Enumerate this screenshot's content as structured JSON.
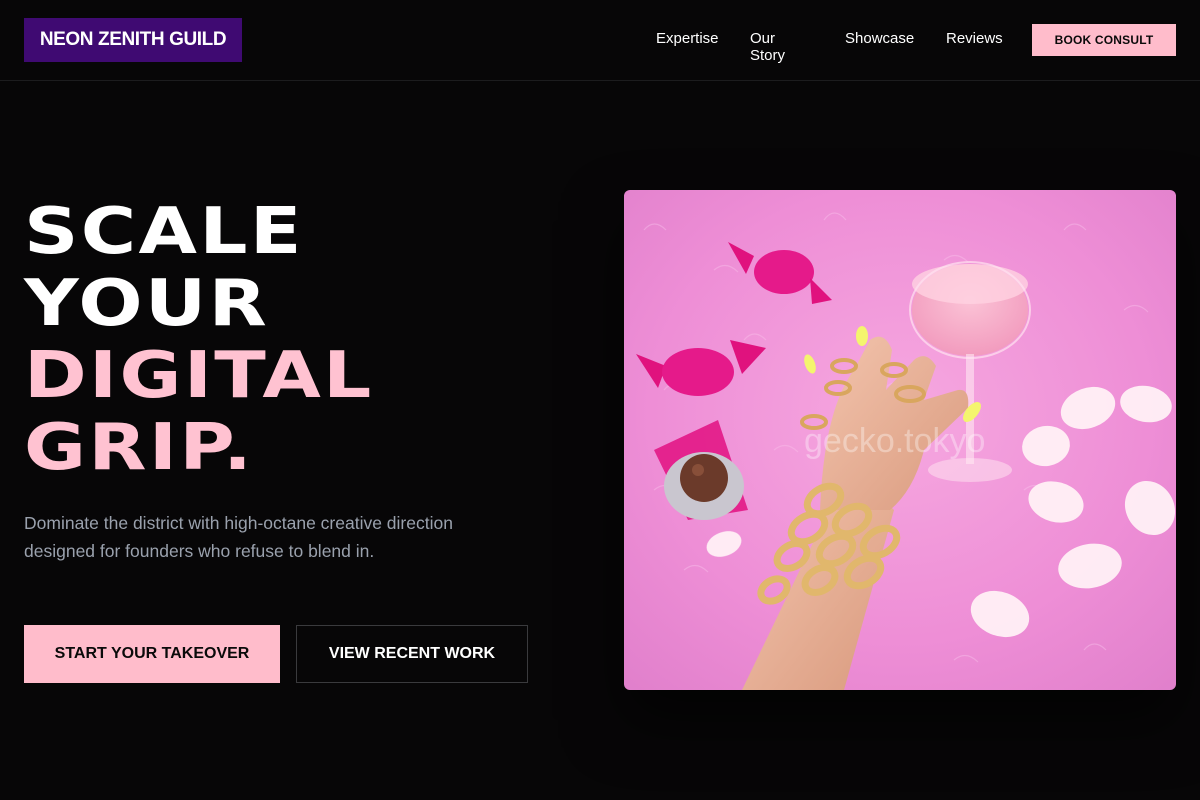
{
  "header": {
    "logo": "NEON ZENITH GUILD",
    "nav": [
      "Expertise",
      "Our Story",
      "Showcase",
      "Reviews"
    ],
    "cta": "BOOK CONSULT"
  },
  "hero": {
    "headline": {
      "line1": "SCALE",
      "line2": "YOUR",
      "line3": "DIGITAL",
      "line4": "GRIP."
    },
    "subtext": "Dominate the district with high-octane creative direction designed for founders who refuse to blend in.",
    "primary_cta": "START YOUR TAKEOVER",
    "secondary_cta": "VIEW RECENT WORK",
    "image_watermark": "gecko.tokyo"
  },
  "colors": {
    "background": "#070607",
    "accent_pink": "#ffbccb",
    "logo_purple": "#3f0a72",
    "subtext_gray": "#9aa1ad"
  }
}
